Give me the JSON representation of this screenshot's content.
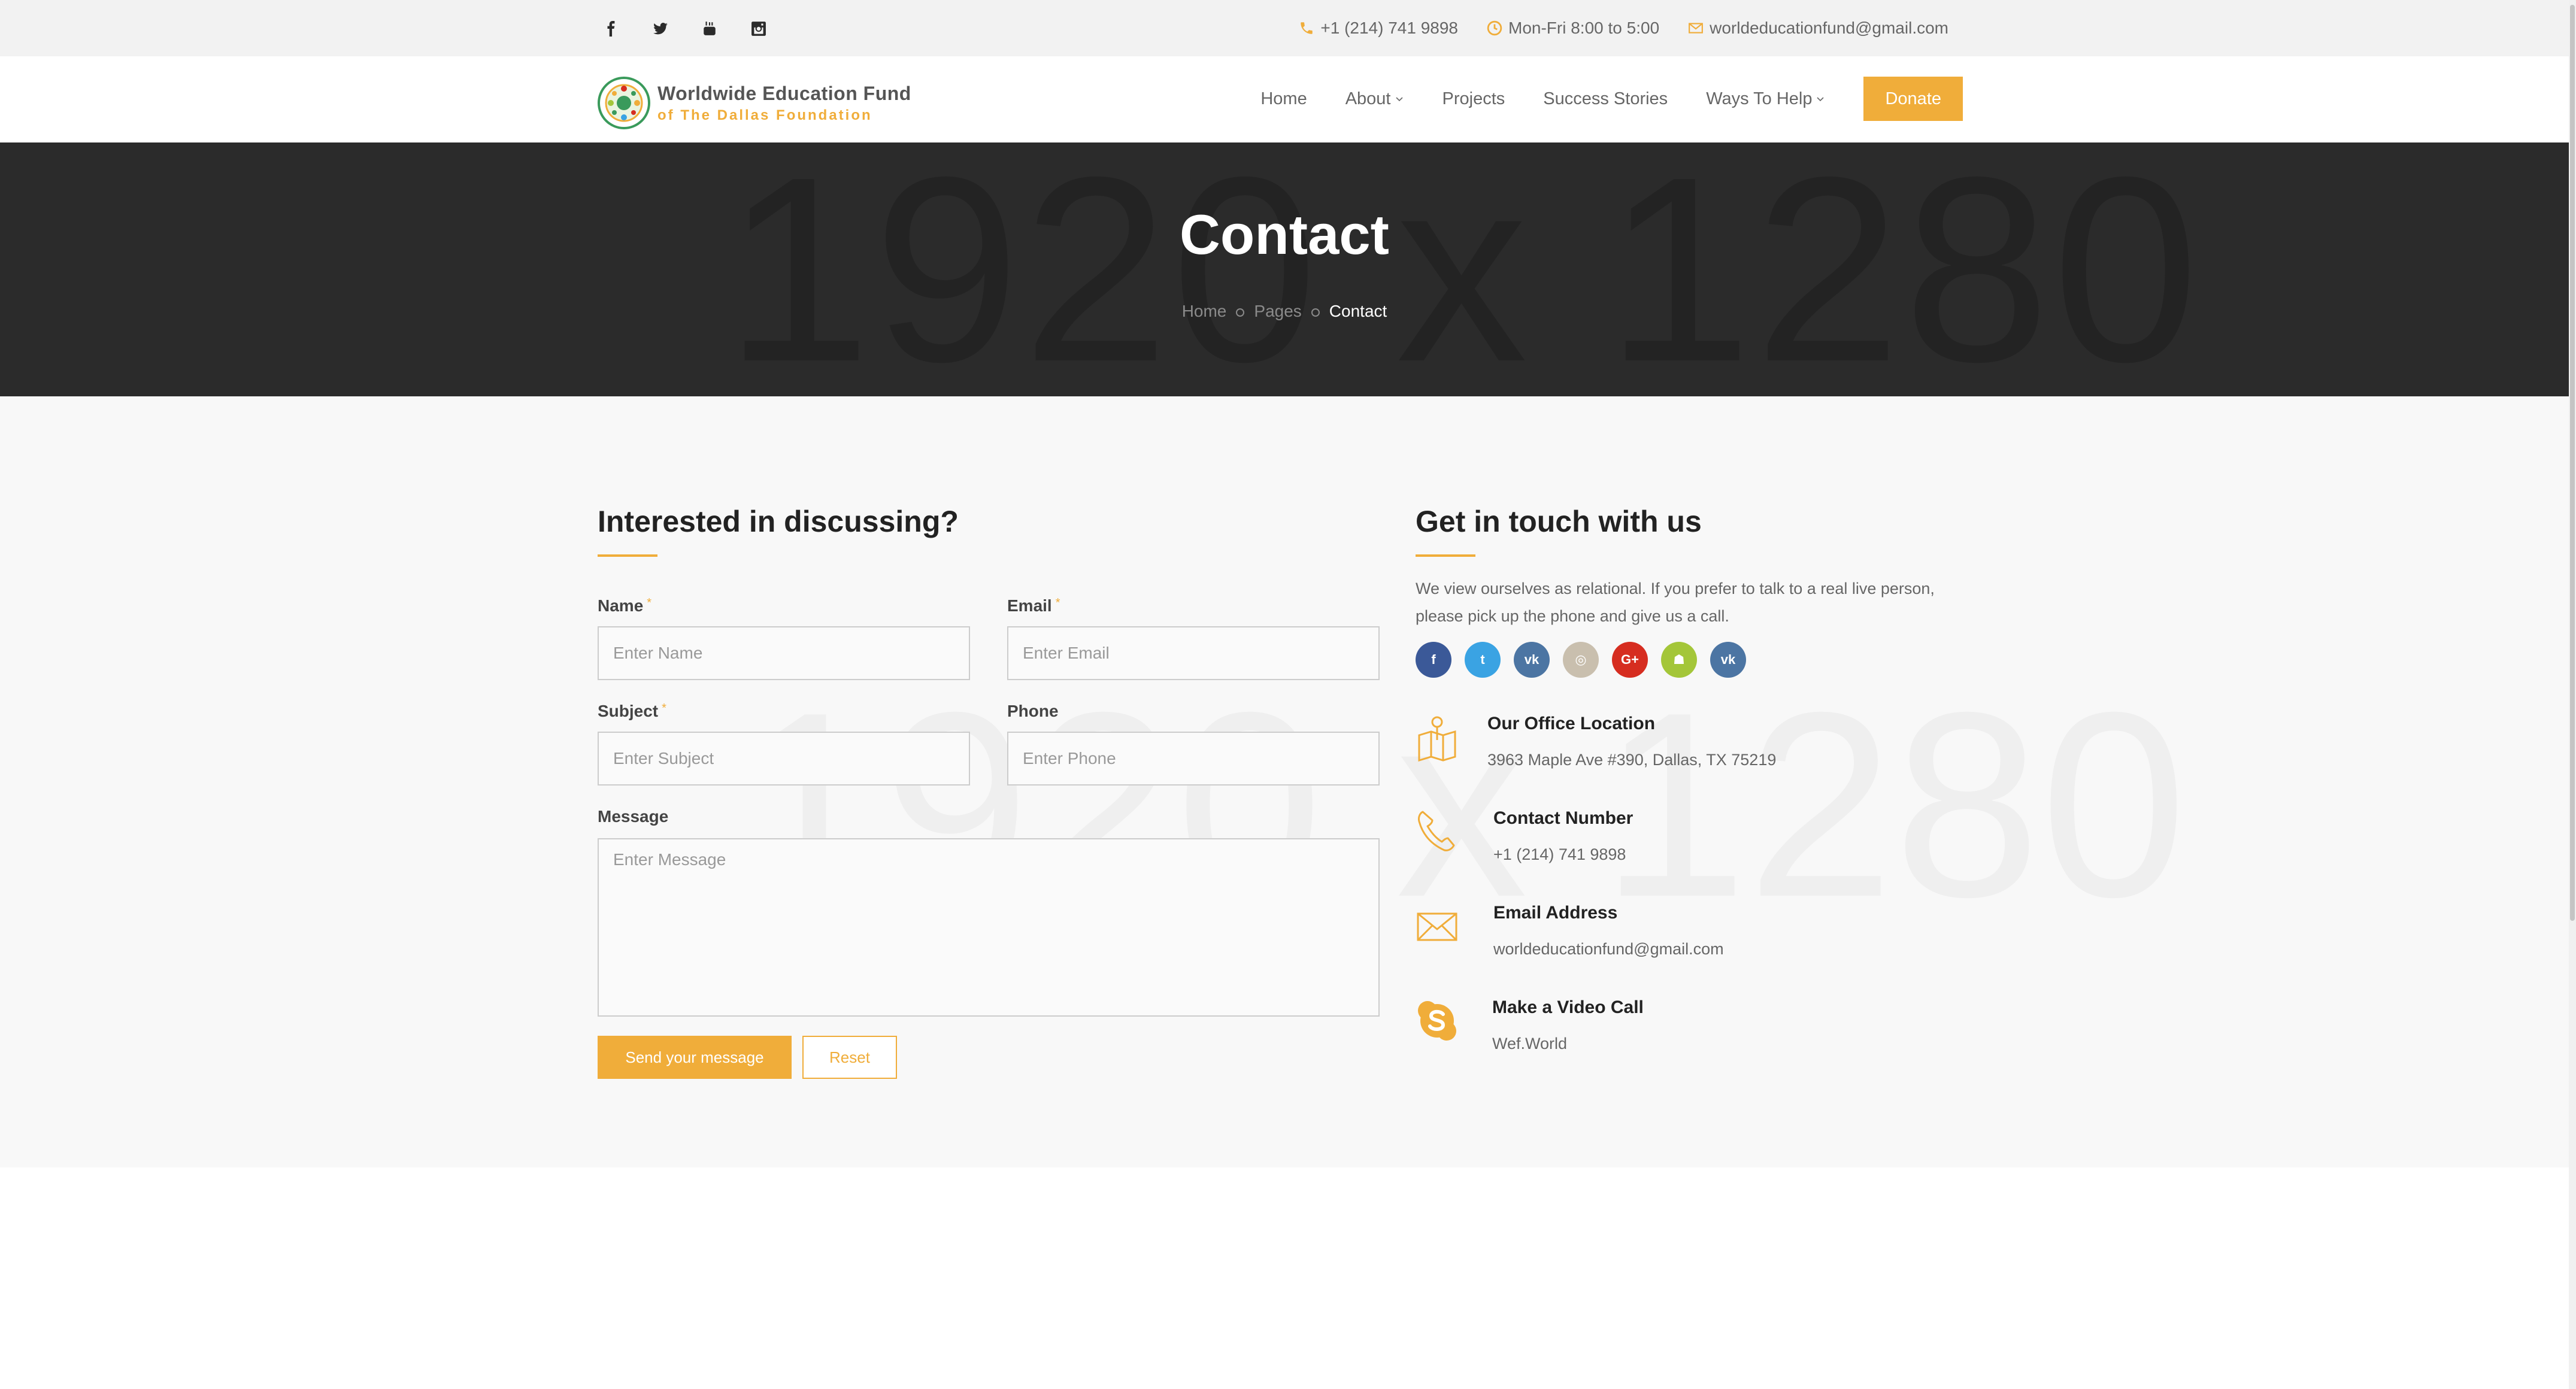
{
  "topbar": {
    "socials": [
      "facebook-icon",
      "twitter-icon",
      "youtube-icon",
      "instagram-icon"
    ],
    "phone": "+1 (214) 741 9898",
    "hours": "Mon-Fri 8:00 to 5:00",
    "email": "worldeducationfund@gmail.com"
  },
  "logo": {
    "line1": "Worldwide Education Fund",
    "line2": "of The Dallas Foundation"
  },
  "nav": {
    "home": "Home",
    "about": "About",
    "projects": "Projects",
    "success": "Success Stories",
    "ways": "Ways To Help",
    "donate": "Donate"
  },
  "hero": {
    "watermark": "1920 x 1280",
    "title": "Contact",
    "crumbs": [
      "Home",
      "Pages",
      "Contact"
    ]
  },
  "form": {
    "heading": "Interested in discussing?",
    "name_label": "Name",
    "name_placeholder": "Enter Name",
    "email_label": "Email",
    "email_placeholder": "Enter Email",
    "subject_label": "Subject",
    "subject_placeholder": "Enter Subject",
    "phone_label": "Phone",
    "phone_placeholder": "Enter Phone",
    "message_label": "Message",
    "message_placeholder": "Enter Message",
    "required_mark": "*",
    "send_label": "Send your message",
    "reset_label": "Reset"
  },
  "touch": {
    "heading": "Get in touch with us",
    "line1": "We view ourselves as relational. If you prefer to talk to a real live person,",
    "line2": "please pick up the phone and give us a call.",
    "social_circles": [
      {
        "icon": "facebook-icon",
        "glyph": "f",
        "color": "#3b5998"
      },
      {
        "icon": "twitter-icon",
        "glyph": "t",
        "color": "#3aa3e3"
      },
      {
        "icon": "vk-icon",
        "glyph": "vk",
        "color": "#4c75a3"
      },
      {
        "icon": "instagram-icon",
        "glyph": "◎",
        "color": "#c9bfae"
      },
      {
        "icon": "google-plus-icon",
        "glyph": "G+",
        "color": "#d62d20"
      },
      {
        "icon": "android-icon",
        "glyph": "☗",
        "color": "#a4c639"
      },
      {
        "icon": "vk-icon",
        "glyph": "vk",
        "color": "#4c75a3"
      }
    ],
    "items": [
      {
        "icon": "map-location-icon",
        "title": "Our Office Location",
        "value": "3963 Maple Ave #390, Dallas, TX 75219"
      },
      {
        "icon": "phone-icon",
        "title": "Contact Number",
        "value": "+1 (214) 741 9898"
      },
      {
        "icon": "envelope-icon",
        "title": "Email Address",
        "value": "worldeducationfund@gmail.com"
      },
      {
        "icon": "skype-icon",
        "title": "Make a Video Call",
        "value": "Wef.World"
      }
    ]
  },
  "colors": {
    "accent": "#f0ad3a",
    "hero_bg": "#2b2b2b",
    "section_bg": "#f8f8f8",
    "topbar_bg": "#f2f2f2"
  }
}
